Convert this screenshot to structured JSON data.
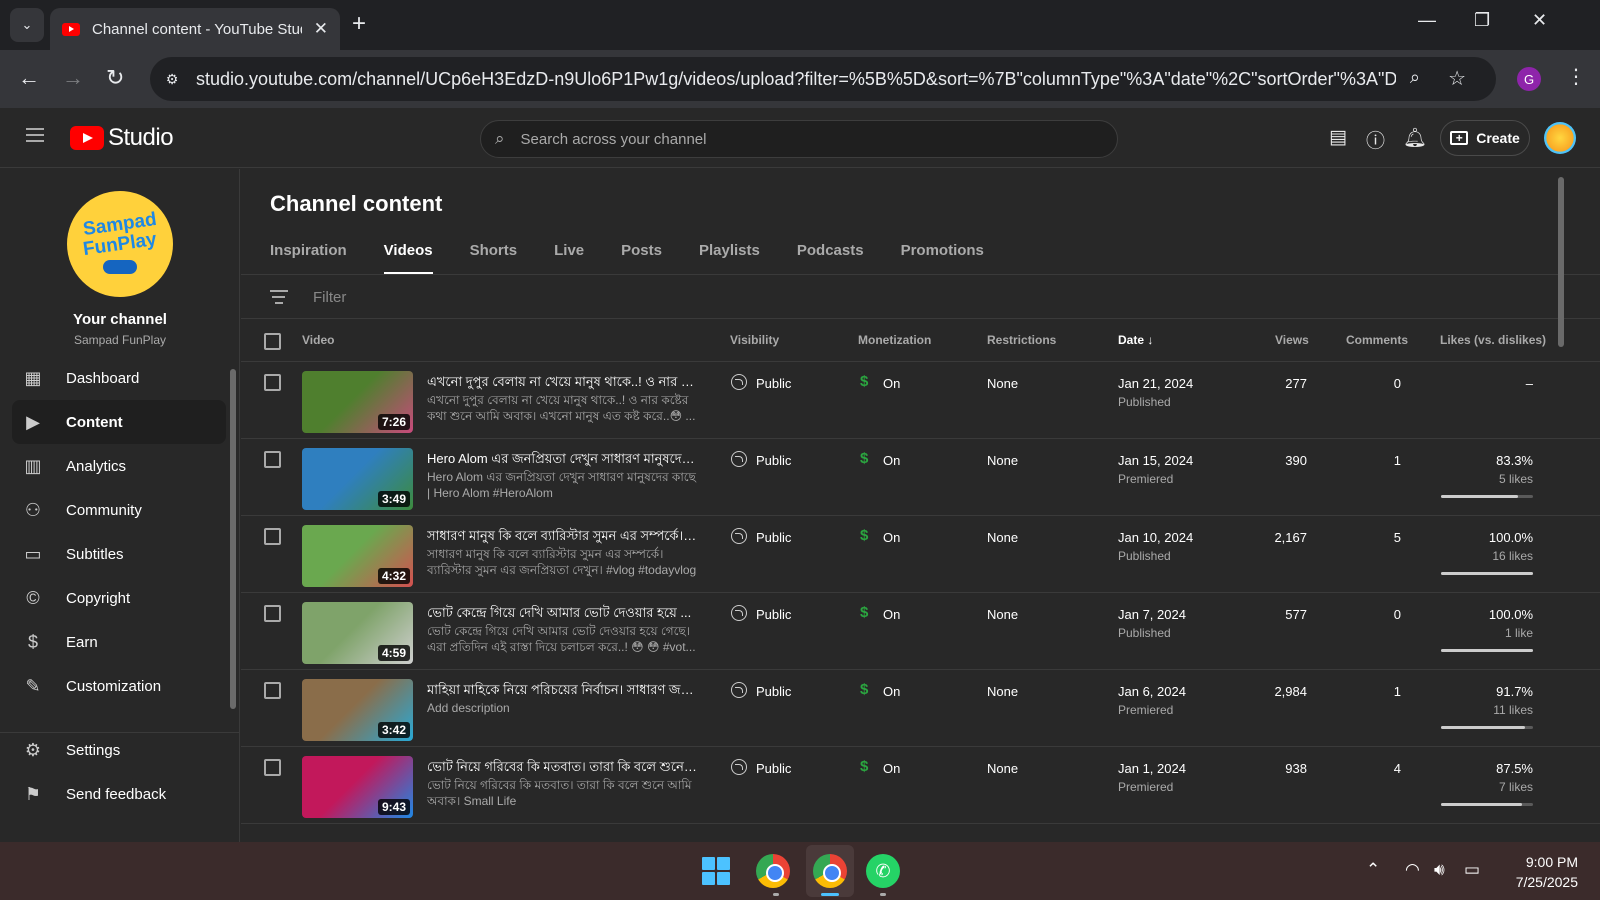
{
  "browser": {
    "tab_title": "Channel content - YouTube Studio",
    "url": "studio.youtube.com/channel/UCp6eH3EdzD-n9Ulo6P1Pw1g/videos/upload?filter=%5B%5D&sort=%7B\"columnType\"%3A\"date\"%2C\"sortOrder\"%3A\"DES...",
    "profile_initial": "G"
  },
  "studio": {
    "logo_text": "Studio",
    "search_placeholder": "Search across your channel",
    "create_label": "Create"
  },
  "sidebar": {
    "channel_avatar_line1": "Sampad",
    "channel_avatar_line2": "FunPlay",
    "your_channel": "Your channel",
    "channel_name": "Sampad FunPlay",
    "items": [
      {
        "label": "Dashboard",
        "icon": "dashboard-icon"
      },
      {
        "label": "Content",
        "icon": "content-icon",
        "active": true
      },
      {
        "label": "Analytics",
        "icon": "analytics-icon"
      },
      {
        "label": "Community",
        "icon": "community-icon"
      },
      {
        "label": "Subtitles",
        "icon": "subtitles-icon"
      },
      {
        "label": "Copyright",
        "icon": "copyright-icon"
      },
      {
        "label": "Earn",
        "icon": "earn-icon"
      },
      {
        "label": "Customization",
        "icon": "customization-icon"
      },
      {
        "label": "Settings",
        "icon": "settings-icon"
      },
      {
        "label": "Send feedback",
        "icon": "feedback-icon"
      }
    ]
  },
  "main": {
    "title": "Channel content",
    "tabs": [
      "Inspiration",
      "Videos",
      "Shorts",
      "Live",
      "Posts",
      "Playlists",
      "Podcasts",
      "Promotions"
    ],
    "active_tab": "Videos",
    "filter_placeholder": "Filter",
    "columns": {
      "video": "Video",
      "visibility": "Visibility",
      "monetization": "Monetization",
      "restrictions": "Restrictions",
      "date": "Date",
      "views": "Views",
      "comments": "Comments",
      "likes": "Likes (vs. dislikes)"
    },
    "rows": [
      {
        "title": "এখনো দুপুর বেলায় না খেয়ে মানুষ থাকে..! ও নার ক...",
        "description": "এখনো দুপুর বেলায় না খেয়ে মানুষ থাকে..! ও নার কষ্টের কথা শুনে আমি অবাক। এখনো মানুষ এত কষ্ট করে..😳 ...",
        "duration": "7:26",
        "visibility": "Public",
        "monetization": "On",
        "restrictions": "None",
        "date": "Jan 21, 2024",
        "status": "Published",
        "views": "277",
        "comments": "0",
        "likes_pct": "–",
        "likes_count": "",
        "ratio": null,
        "thumb": [
          "#4f7f2e",
          "#c84a7c"
        ]
      },
      {
        "title": "Hero Alom এর জনপ্রিয়তা দেখুন সাধারণ মানুষদের ...",
        "description": "Hero Alom এর জনপ্রিয়তা দেখুন সাধারণ মানুষদের কাছে | Hero Alom #HeroAlom",
        "duration": "3:49",
        "visibility": "Public",
        "monetization": "On",
        "restrictions": "None",
        "date": "Jan 15, 2024",
        "status": "Premiered",
        "views": "390",
        "comments": "1",
        "likes_pct": "83.3%",
        "likes_count": "5 likes",
        "ratio": 0.833,
        "thumb": [
          "#2f7fbf",
          "#3d8b3d"
        ]
      },
      {
        "title": "সাধারণ মানুষ কি বলে ব্যারিস্টার সুমন এর সম্পর্কে। ...",
        "description": "সাধারণ মানুষ কি বলে ব্যারিস্টার সুমন এর সম্পর্কে। ব্যারিস্টার সুমন এর জনপ্রিয়তা দেখুন। #vlog #todayvlog",
        "duration": "4:32",
        "visibility": "Public",
        "monetization": "On",
        "restrictions": "None",
        "date": "Jan 10, 2024",
        "status": "Published",
        "views": "2,167",
        "comments": "5",
        "likes_pct": "100.0%",
        "likes_count": "16 likes",
        "ratio": 1.0,
        "thumb": [
          "#6aa84f",
          "#d45050"
        ]
      },
      {
        "title": "ভোট কেন্দ্রে গিয়ে দেখি আমার ভোট দেওয়ার হয়ে ...",
        "description": "ভোট কেন্দ্রে গিয়ে দেখি আমার ভোট দেওয়ার হয়ে গেছে। এরা প্রতিদিন এই রাস্তা দিয়ে চলাচল করে..! 😳 😳 #vot...",
        "duration": "4:59",
        "visibility": "Public",
        "monetization": "On",
        "restrictions": "None",
        "date": "Jan 7, 2024",
        "status": "Published",
        "views": "577",
        "comments": "0",
        "likes_pct": "100.0%",
        "likes_count": "1 like",
        "ratio": 1.0,
        "thumb": [
          "#7fa36a",
          "#cfcfcf"
        ]
      },
      {
        "title": "মাহিয়া মাহিকে নিয়ে পরিচয়ের নির্বাচন। সাধারণ জন...",
        "description": "Add description",
        "duration": "3:42",
        "visibility": "Public",
        "monetization": "On",
        "restrictions": "None",
        "date": "Jan 6, 2024",
        "status": "Premiered",
        "views": "2,984",
        "comments": "1",
        "likes_pct": "91.7%",
        "likes_count": "11 likes",
        "ratio": 0.917,
        "thumb": [
          "#8a6d4a",
          "#29a9d6"
        ]
      },
      {
        "title": "ভোট নিয়ে গরিবের কি মতবাত। তারা কি বলে শুনে ...",
        "description": "ভোট নিয়ে গরিবের কি মতবাত। তারা কি বলে শুনে আমি অবাক। Small Life",
        "duration": "9:43",
        "visibility": "Public",
        "monetization": "On",
        "restrictions": "None",
        "date": "Jan 1, 2024",
        "status": "Premiered",
        "views": "938",
        "comments": "4",
        "likes_pct": "87.5%",
        "likes_count": "7 likes",
        "ratio": 0.875,
        "thumb": [
          "#c2185b",
          "#1e88e5"
        ]
      }
    ]
  },
  "taskbar": {
    "time": "9:00 PM",
    "date": "7/25/2025"
  }
}
